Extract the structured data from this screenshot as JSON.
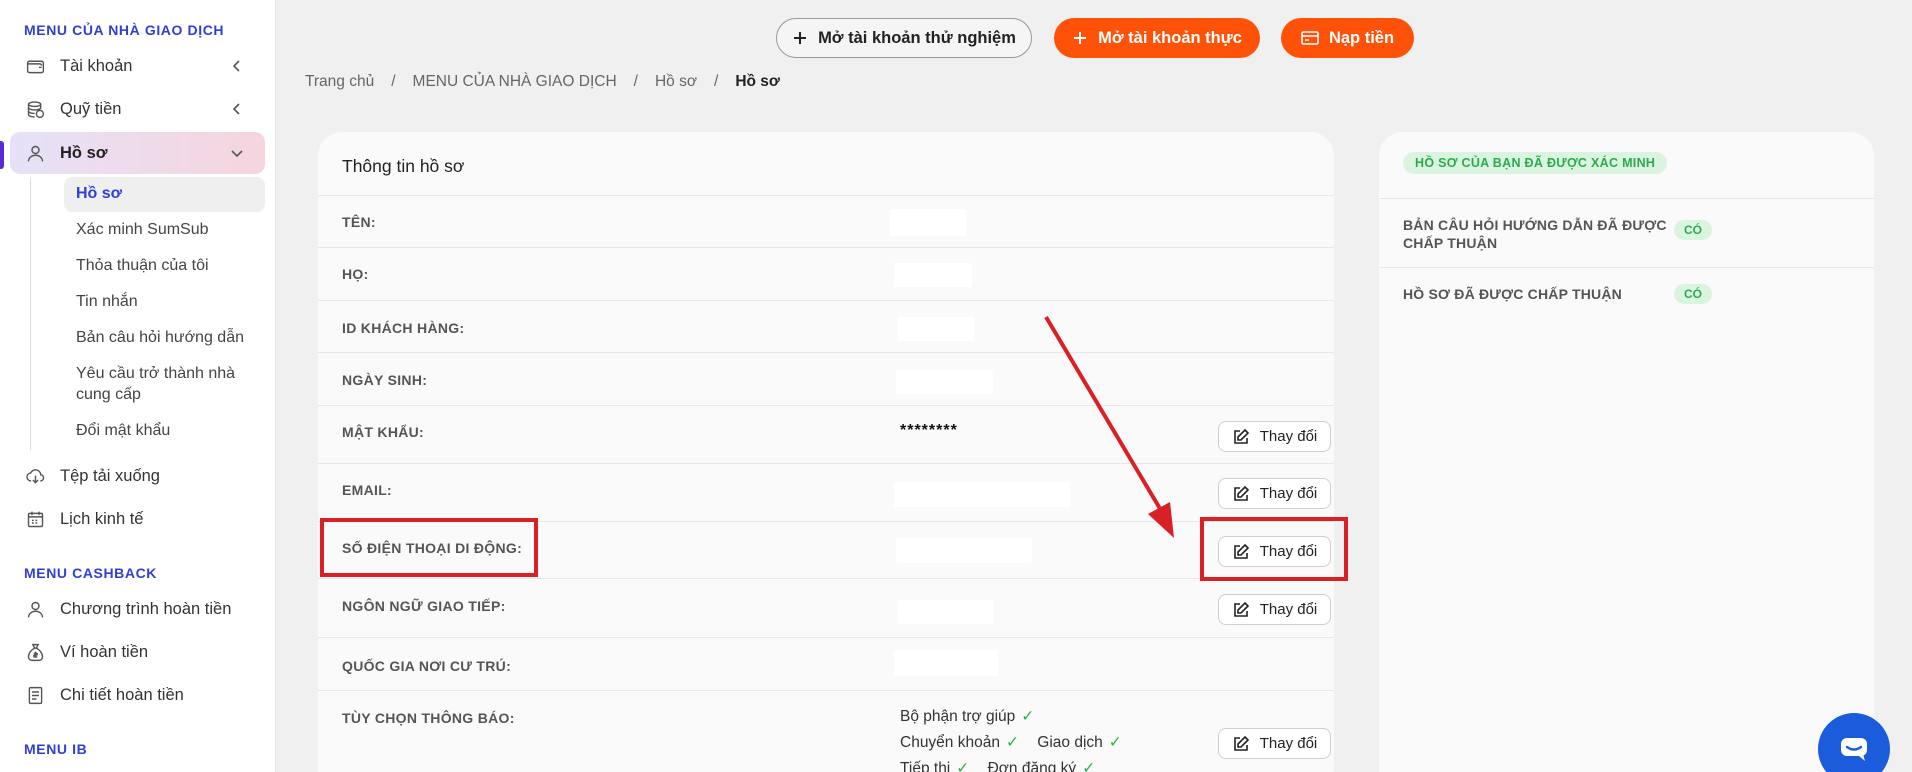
{
  "sidebar": {
    "section_trader": "MENU CỦA NHÀ GIAO DỊCH",
    "section_cashback": "MENU CASHBACK",
    "section_ib": "MENU IB",
    "items": [
      {
        "label": "Tài khoản",
        "icon": "wallet-icon"
      },
      {
        "label": "Quỹ tiền",
        "icon": "coins-icon"
      },
      {
        "label": "Hồ sơ",
        "icon": "user-icon"
      },
      {
        "label": "Tệp tải xuống",
        "icon": "cloud-download-icon"
      },
      {
        "label": "Lịch kinh tế",
        "icon": "calendar-icon"
      }
    ],
    "sub_items": [
      {
        "label": "Hồ sơ"
      },
      {
        "label": "Xác minh SumSub"
      },
      {
        "label": "Thỏa thuận của tôi"
      },
      {
        "label": "Tin nhắn"
      },
      {
        "label": "Bản câu hỏi hướng dẫn"
      },
      {
        "label": "Yêu cầu trở thành nhà cung cấp"
      },
      {
        "label": "Đổi mật khẩu"
      }
    ],
    "cashback_items": [
      {
        "label": "Chương trình hoàn tiền",
        "icon": "user-icon"
      },
      {
        "label": "Ví hoàn tiền",
        "icon": "money-bag-icon"
      },
      {
        "label": "Chi tiết hoàn tiền",
        "icon": "document-icon"
      }
    ]
  },
  "topbar": {
    "demo_label": "Mở tài khoản thử nghiệm",
    "real_label": "Mở tài khoản thực",
    "deposit_label": "Nạp tiền"
  },
  "breadcrumb": {
    "home": "Trang chủ",
    "section": "MENU CỦA NHÀ GIAO DỊCH",
    "parent": "Hồ sơ",
    "current": "Hồ sơ"
  },
  "profile": {
    "title": "Thông tin hồ sơ",
    "change_label": "Thay đổi",
    "fields": {
      "first_name": "TÊN:",
      "last_name": "HỌ:",
      "client_id": "ID KHÁCH HÀNG:",
      "birth_date": "NGÀY SINH:",
      "password": "MẬT KHẨU:",
      "email": "EMAIL:",
      "phone": "SỐ ĐIỆN THOẠI DI ĐỘNG:",
      "language": "NGÔN NGỮ GIAO TIẾP:",
      "country": "QUỐC GIA NƠI CƯ TRÚ:",
      "notifications": "TÙY CHỌN THÔNG BÁO:"
    },
    "password_value": "********",
    "notification_options": {
      "support": "Bộ phận trợ giúp",
      "transfer": "Chuyển khoản",
      "trading": "Giao dịch",
      "marketing": "Tiếp thị",
      "registration": "Đơn đăng ký"
    }
  },
  "status": {
    "verified_badge": "HỒ SƠ CỦA BẠN ĐÃ ĐƯỢC XÁC MINH",
    "questionnaire_label": "BẢN CÂU HỎI HƯỚNG DẪN ĐÃ ĐƯỢC CHẤP THUẬN",
    "questionnaire_value": "CÓ",
    "profile_label": "HỒ SƠ ĐÃ ĐƯỢC CHẤP THUẬN",
    "profile_value": "CÓ"
  },
  "colors": {
    "accent": "#2f3fd6",
    "orange": "#ff5209",
    "annotation_red": "#d92024",
    "success": "#2eaa4e"
  }
}
